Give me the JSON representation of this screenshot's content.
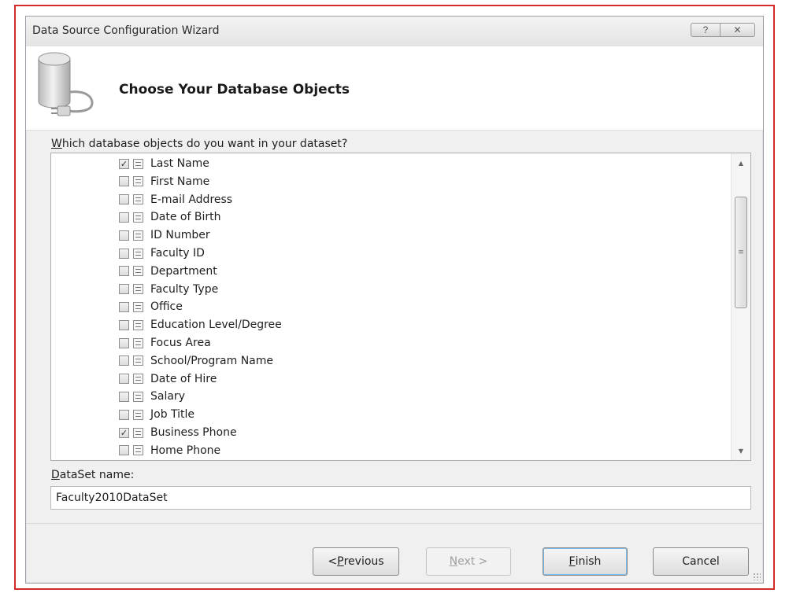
{
  "window": {
    "title": "Data Source Configuration Wizard",
    "help_label": "?",
    "close_label": "✕"
  },
  "header": {
    "title": "Choose Your Database Objects",
    "icon": "database-connection-icon"
  },
  "question": {
    "accel": "W",
    "rest": "hich database objects do you want in your dataset?"
  },
  "objects": [
    {
      "label": "Last Name",
      "checked": true
    },
    {
      "label": "First Name",
      "checked": false
    },
    {
      "label": "E-mail Address",
      "checked": false
    },
    {
      "label": "Date of Birth",
      "checked": false
    },
    {
      "label": "ID Number",
      "checked": false
    },
    {
      "label": "Faculty ID",
      "checked": false
    },
    {
      "label": "Department",
      "checked": false
    },
    {
      "label": "Faculty Type",
      "checked": false
    },
    {
      "label": "Office",
      "checked": false
    },
    {
      "label": "Education Level/Degree",
      "checked": false
    },
    {
      "label": "Focus Area",
      "checked": false
    },
    {
      "label": "School/Program Name",
      "checked": false
    },
    {
      "label": "Date of Hire",
      "checked": false
    },
    {
      "label": "Salary",
      "checked": false
    },
    {
      "label": "Job Title",
      "checked": false
    },
    {
      "label": "Business Phone",
      "checked": true
    },
    {
      "label": "Home Phone",
      "checked": false
    }
  ],
  "dataset": {
    "accel": "D",
    "label_rest": "ataSet name:",
    "value": "Faculty2010DataSet"
  },
  "buttons": {
    "previous": {
      "prefix": "< ",
      "accel": "P",
      "rest": "revious"
    },
    "next": {
      "accel": "N",
      "rest": "ext >"
    },
    "finish": {
      "accel": "F",
      "rest": "inish"
    },
    "cancel": "Cancel"
  }
}
